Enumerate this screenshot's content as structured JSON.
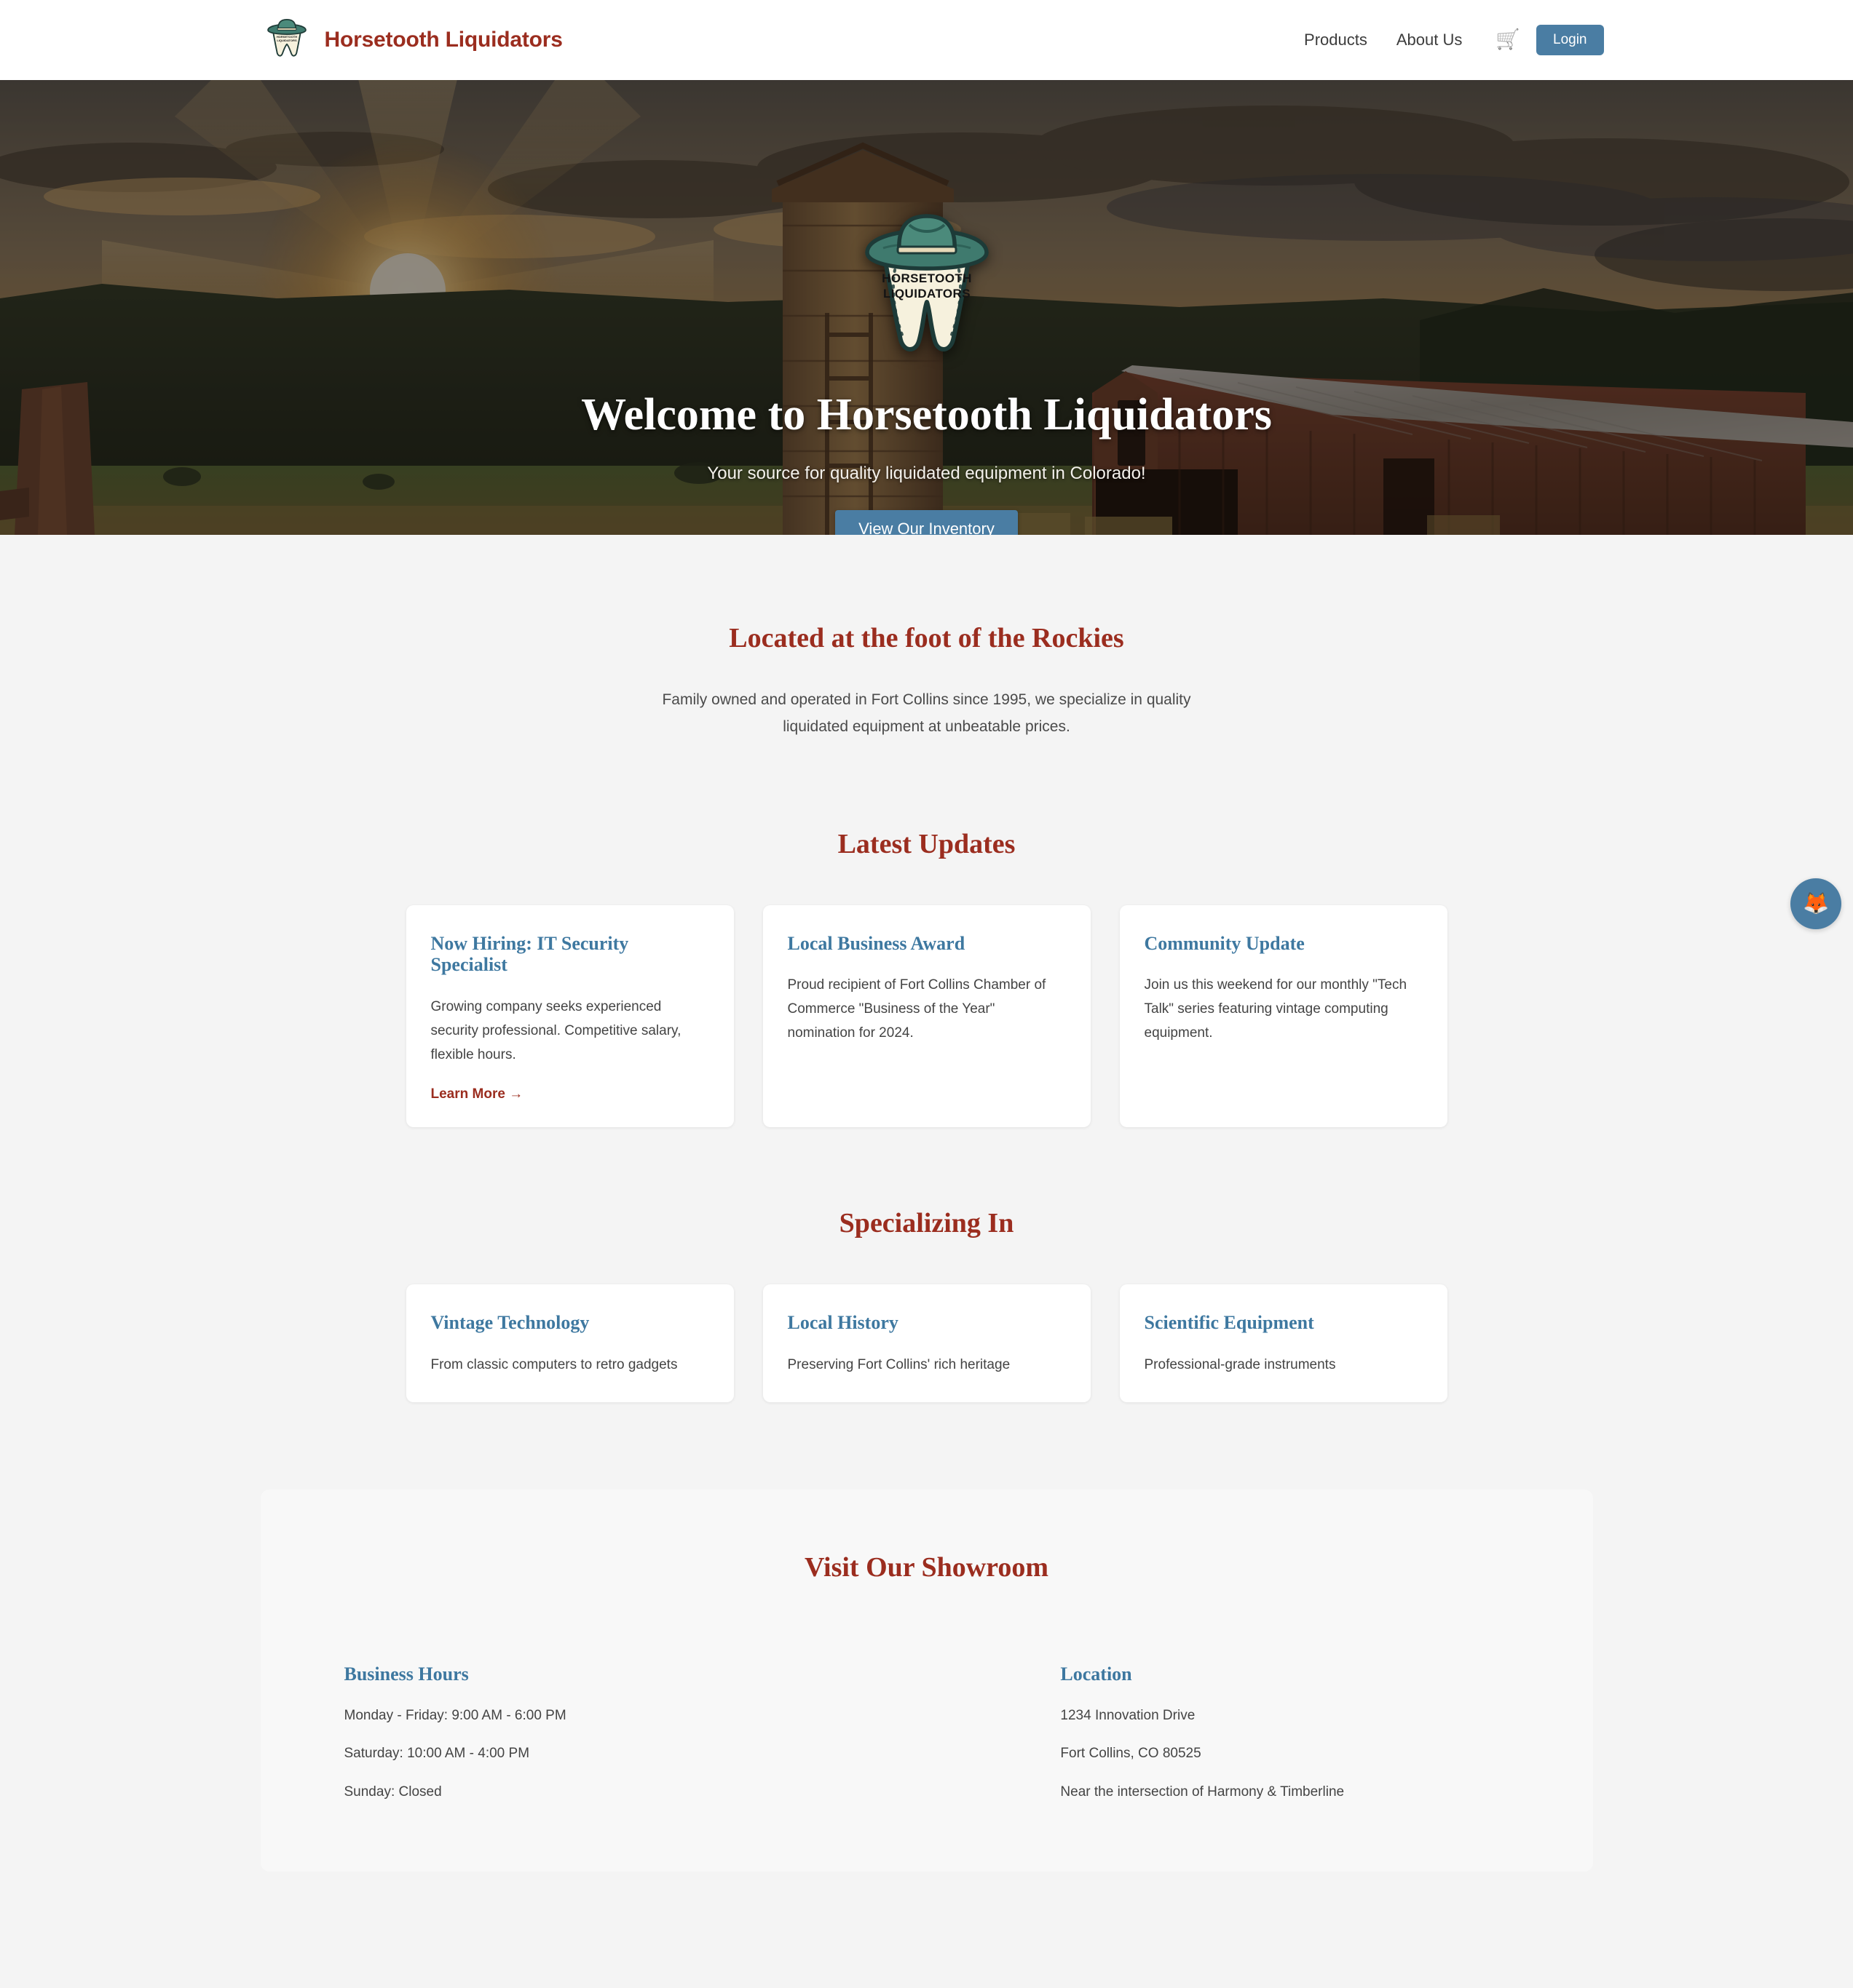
{
  "header": {
    "brand_name": "Horsetooth Liquidators",
    "logo_icon": "tooth-cowboy-hat-logo",
    "nav": [
      {
        "label": "Products"
      },
      {
        "label": "About Us"
      }
    ],
    "cart_icon": "shopping-cart-icon",
    "cart_glyph": "🛒",
    "login_label": "Login"
  },
  "hero": {
    "badge_icon": "tooth-cowboy-hat-badge",
    "badge_text_line1": "HORSETOOTH",
    "badge_text_line2": "LIQUIDATORS",
    "title": "Welcome to Horsetooth Liquidators",
    "subtitle": "Your source for quality liquidated equipment in Colorado!",
    "cta_label": "View Our Inventory"
  },
  "intro": {
    "title": "Located at the foot of the Rockies",
    "body": "Family owned and operated in Fort Collins since 1995, we specialize in quality liquidated equipment at unbeatable prices."
  },
  "updates": {
    "title": "Latest Updates",
    "cards": [
      {
        "title": "Now Hiring: IT Security Specialist",
        "text": "Growing company seeks experienced security professional. Competitive salary, flexible hours.",
        "link": "Learn More →"
      },
      {
        "title": "Local Business Award",
        "text": "Proud recipient of Fort Collins Chamber of Commerce \"Business of the Year\" nomination for 2024.",
        "link": ""
      },
      {
        "title": "Community Update",
        "text": "Join us this weekend for our monthly \"Tech Talk\" series featuring vintage computing equipment.",
        "link": ""
      }
    ]
  },
  "specializing": {
    "title": "Specializing In",
    "cards": [
      {
        "title": "Vintage Technology",
        "text": "From classic computers to retro gadgets"
      },
      {
        "title": "Local History",
        "text": "Preserving Fort Collins' rich heritage"
      },
      {
        "title": "Scientific Equipment",
        "text": "Professional-grade instruments"
      }
    ]
  },
  "showroom": {
    "title": "Visit Our Showroom",
    "hours": {
      "title": "Business Hours",
      "lines": [
        "Monday - Friday: 9:00 AM - 6:00 PM",
        "Saturday: 10:00 AM - 4:00 PM",
        "Sunday: Closed"
      ]
    },
    "location": {
      "title": "Location",
      "lines": [
        "1234 Innovation Drive",
        "Fort Collins, CO 80525",
        "Near the intersection of Harmony & Timberline"
      ]
    }
  },
  "fab": {
    "icon": "fox-face-icon",
    "glyph": "🦊"
  },
  "colors": {
    "brand_red": "#9b2d1f",
    "accent_blue": "#4a7da3",
    "card_title_blue": "#3e78a0",
    "page_bg": "#f4f4f4",
    "card_bg": "#ffffff",
    "showroom_bg": "#f8f8f8",
    "hat_green": "#3f7a6e",
    "tooth_cream": "#f6f1dd"
  }
}
